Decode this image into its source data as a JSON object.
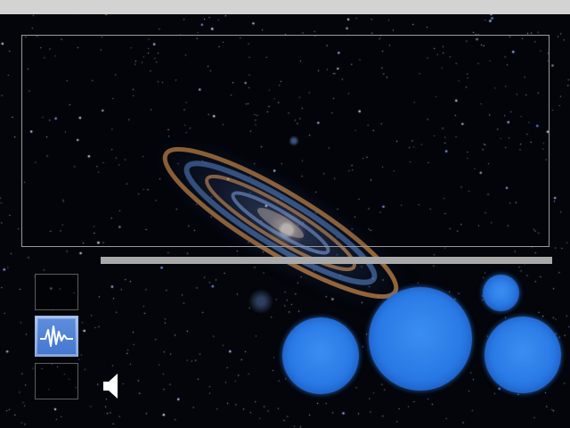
{
  "background": {
    "scene": "andromeda-galaxy-starfield"
  },
  "colors": {
    "top_bar": "#d3d3d3",
    "panel_border": "#9a9a9a",
    "progress_track": "#a9a9a9",
    "orb_blue": "#2a7ae6",
    "selected_slot": "#5a88d8"
  },
  "progress": {
    "fraction": 0
  },
  "slots": [
    {
      "icon": "empty",
      "selected": false
    },
    {
      "icon": "waveform-icon",
      "selected": true
    },
    {
      "icon": "empty",
      "selected": false
    }
  ],
  "speaker": {
    "icon": "speaker-icon"
  },
  "orbs": [
    {
      "name": "orb-1"
    },
    {
      "name": "orb-2"
    },
    {
      "name": "orb-3"
    },
    {
      "name": "orb-4"
    }
  ]
}
